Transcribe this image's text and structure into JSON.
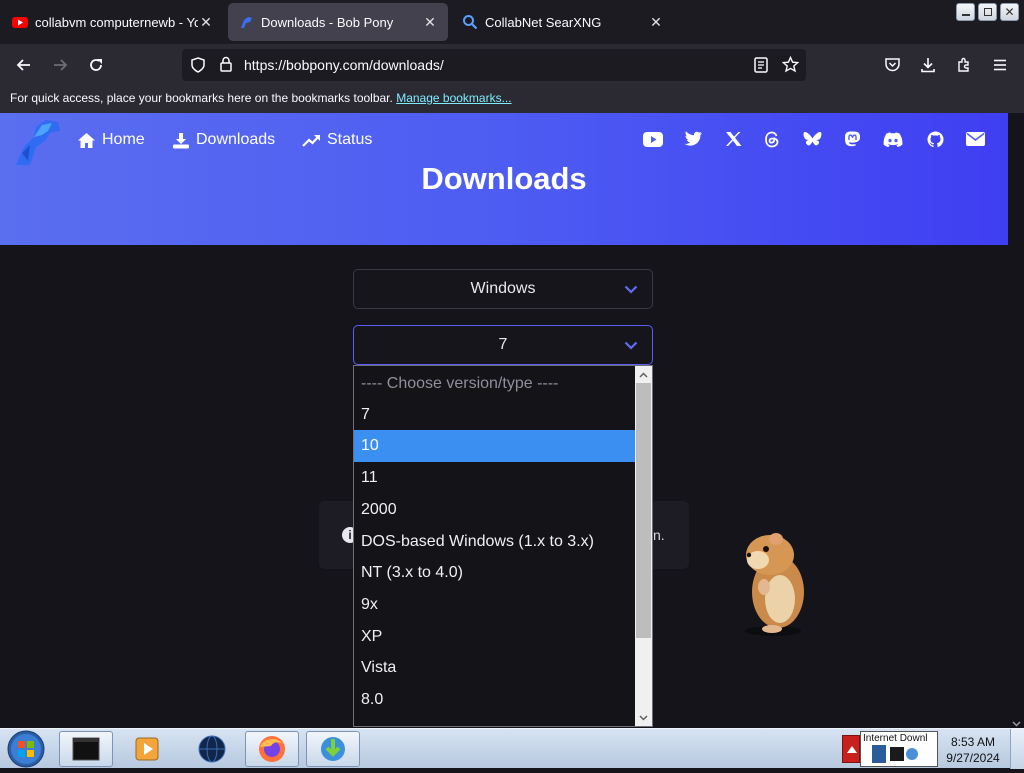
{
  "browser": {
    "tabs": [
      {
        "title": "collabvm computernewb - You",
        "favicon": "youtube-icon",
        "active": false
      },
      {
        "title": "Downloads - Bob Pony",
        "favicon": "bobpony-icon",
        "active": true
      },
      {
        "title": "CollabNet SearXNG",
        "favicon": "search-icon",
        "active": false
      }
    ],
    "url": "https://bobpony.com/downloads/",
    "bookmarks_message": "For quick access, place your bookmarks here on the bookmarks toolbar.",
    "manage_bookmarks_label": "Manage bookmarks..."
  },
  "site": {
    "nav": [
      {
        "label": "Home",
        "icon": "home-icon"
      },
      {
        "label": "Downloads",
        "icon": "download-icon"
      },
      {
        "label": "Status",
        "icon": "trend-icon"
      }
    ],
    "socials": [
      "youtube-icon",
      "twitter-icon",
      "x-icon",
      "threads-icon",
      "bluesky-icon",
      "mastodon-icon",
      "discord-icon",
      "github-icon",
      "email-icon"
    ],
    "hero_title": "Downloads",
    "os_select_value": "Windows",
    "version_select_value": "7",
    "background_card_fragment": "n.",
    "dropdown": {
      "placeholder": "---- Choose version/type ----",
      "options": [
        "7",
        "10",
        "11",
        "2000",
        "DOS-based Windows (1.x to 3.x)",
        "NT (3.x to 4.0)",
        "9x",
        "XP",
        "Vista",
        "8.0"
      ],
      "highlighted": "10"
    }
  },
  "taskbar": {
    "time": "8:53 AM",
    "date": "9/27/2024",
    "tray_tooltip": "Internet Downl"
  },
  "colors": {
    "accent": "#4d5cf2",
    "highlight": "#3b8ff0",
    "page_bg": "#15141a"
  }
}
